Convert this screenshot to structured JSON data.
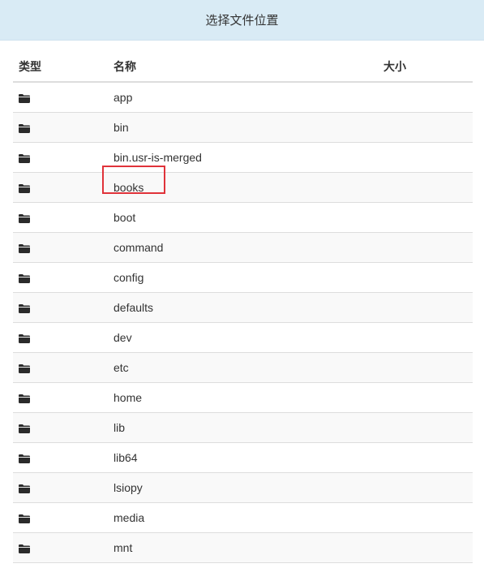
{
  "header": {
    "title": "选择文件位置"
  },
  "table": {
    "columns": {
      "type": "类型",
      "name": "名称",
      "size": "大小"
    },
    "rows": [
      {
        "name": "app",
        "size": ""
      },
      {
        "name": "bin",
        "size": ""
      },
      {
        "name": "bin.usr-is-merged",
        "size": ""
      },
      {
        "name": "books",
        "size": "",
        "highlighted": true
      },
      {
        "name": "boot",
        "size": ""
      },
      {
        "name": "command",
        "size": ""
      },
      {
        "name": "config",
        "size": ""
      },
      {
        "name": "defaults",
        "size": ""
      },
      {
        "name": "dev",
        "size": ""
      },
      {
        "name": "etc",
        "size": ""
      },
      {
        "name": "home",
        "size": ""
      },
      {
        "name": "lib",
        "size": ""
      },
      {
        "name": "lib64",
        "size": ""
      },
      {
        "name": "lsiopy",
        "size": ""
      },
      {
        "name": "media",
        "size": ""
      },
      {
        "name": "mnt",
        "size": ""
      }
    ],
    "row_icon": "folder-icon",
    "highlight_color": "#e0333a"
  }
}
